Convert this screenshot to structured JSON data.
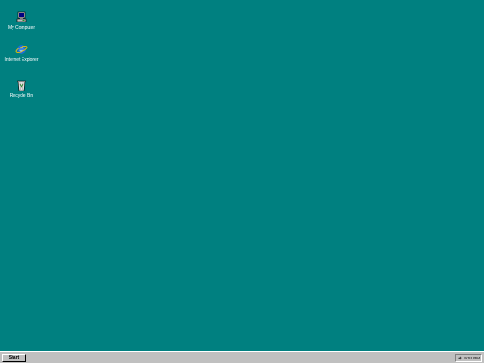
{
  "desktop": {
    "background": "#008080",
    "icons": [
      {
        "label": "My Computer",
        "icon": "my-computer-icon"
      },
      {
        "label": "Internet Explorer",
        "icon": "internet-explorer-icon"
      },
      {
        "label": "Recycle Bin",
        "icon": "recycle-bin-icon"
      }
    ]
  },
  "taskbar": {
    "start_label": "Start",
    "clock": "9:53 PM",
    "tray_icon": "speaker-icon"
  }
}
